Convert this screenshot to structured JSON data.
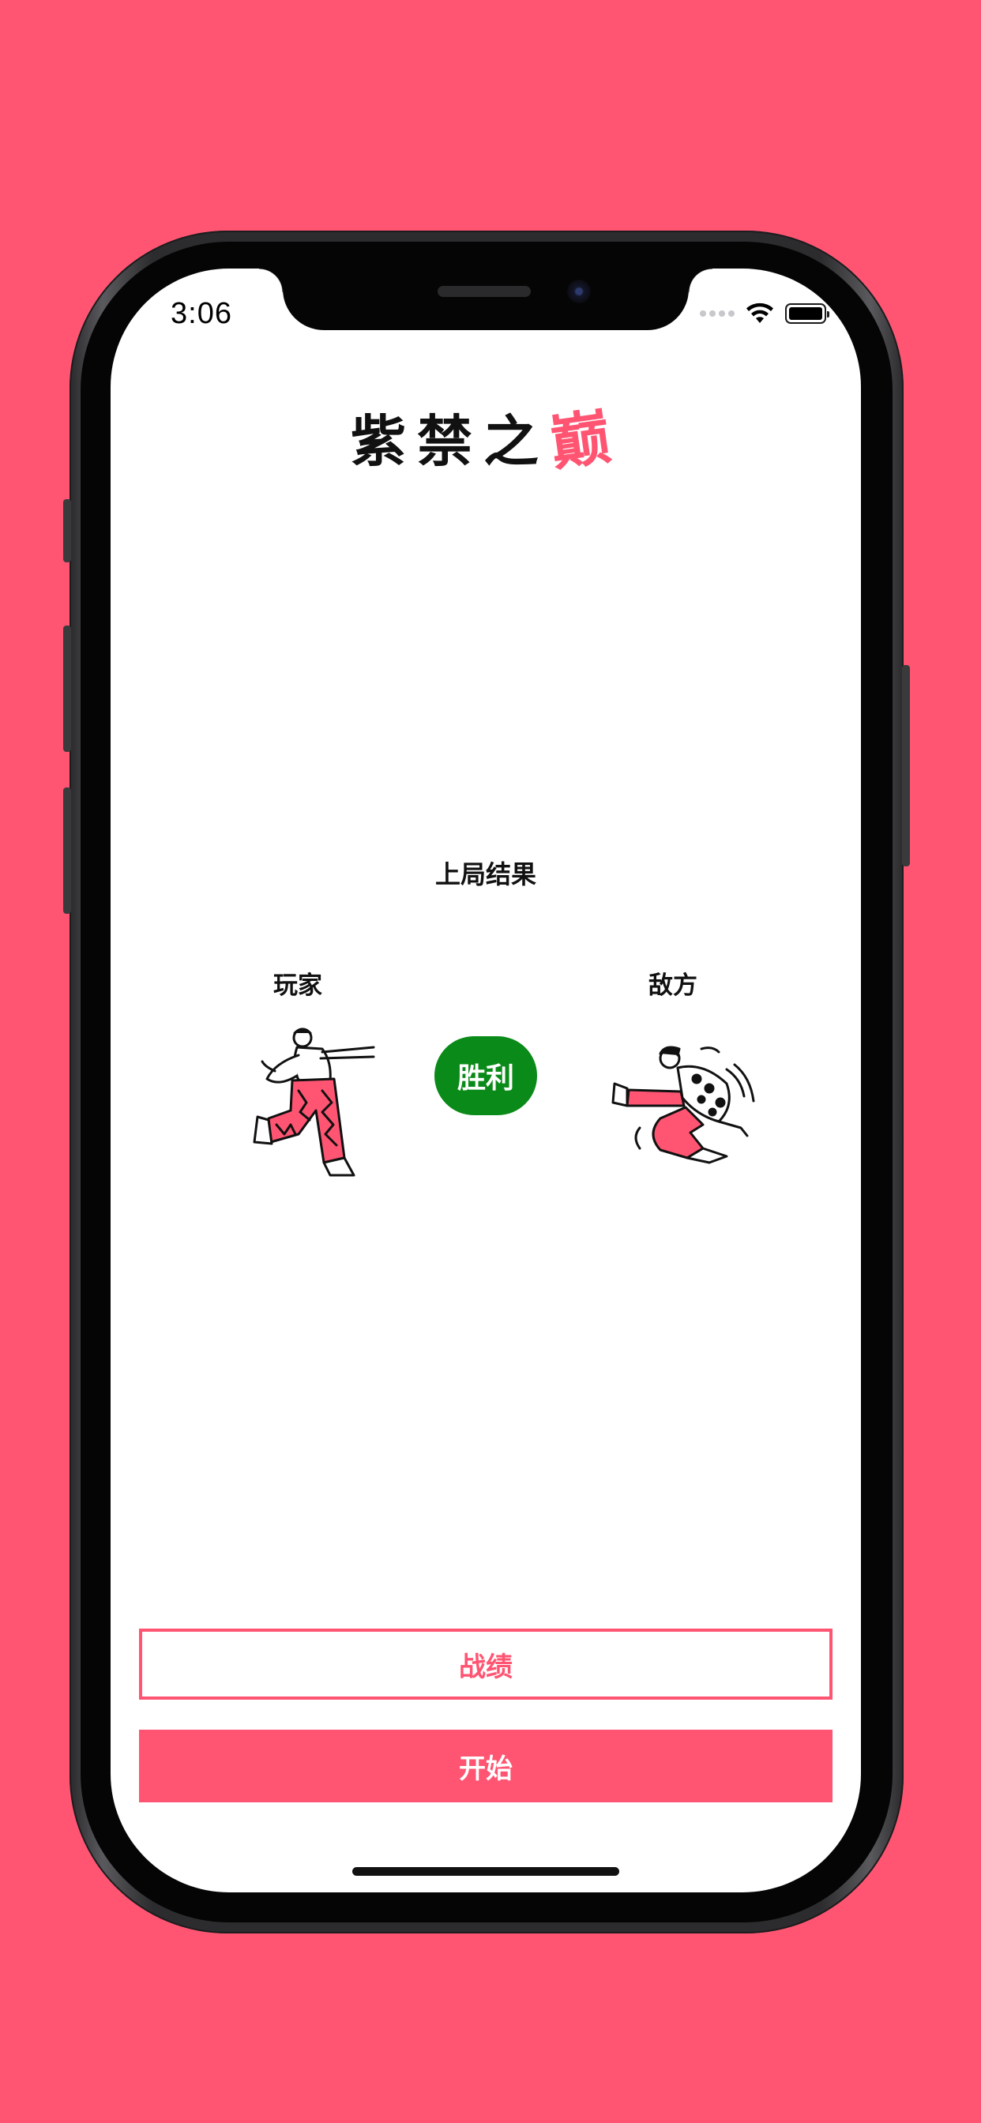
{
  "status_bar": {
    "time": "3:06"
  },
  "app": {
    "title_main": "紫禁之",
    "title_accent": "巅"
  },
  "result": {
    "section_title": "上局结果",
    "player_label": "玩家",
    "enemy_label": "敌方",
    "outcome_badge": "胜利"
  },
  "actions": {
    "record_label": "战绩",
    "start_label": "开始"
  },
  "colors": {
    "background": "#FF5572",
    "accent": "#FF5572",
    "win": "#0A8A18"
  },
  "icons": {
    "wifi": "wifi-icon",
    "battery": "battery-icon",
    "signal": "cellular-signal-icon"
  }
}
